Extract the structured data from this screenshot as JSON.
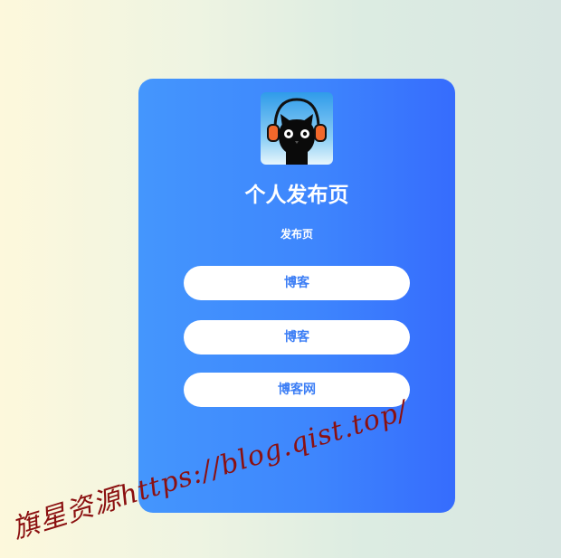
{
  "profile": {
    "title": "个人发布页",
    "subtitle": "发布页",
    "avatar_icon": "black-cat-with-headphones-icon"
  },
  "links": [
    {
      "label": "博客"
    },
    {
      "label": "博客"
    },
    {
      "label": "博客网"
    }
  ],
  "watermark": {
    "text": "旗星资源https://blog.qist.top/"
  },
  "colors": {
    "card_gradient_start": "#4496fd",
    "card_gradient_end": "#366cfd",
    "button_bg": "#ffffff",
    "button_text": "#3c7ef5",
    "watermark": "#8b1010"
  }
}
